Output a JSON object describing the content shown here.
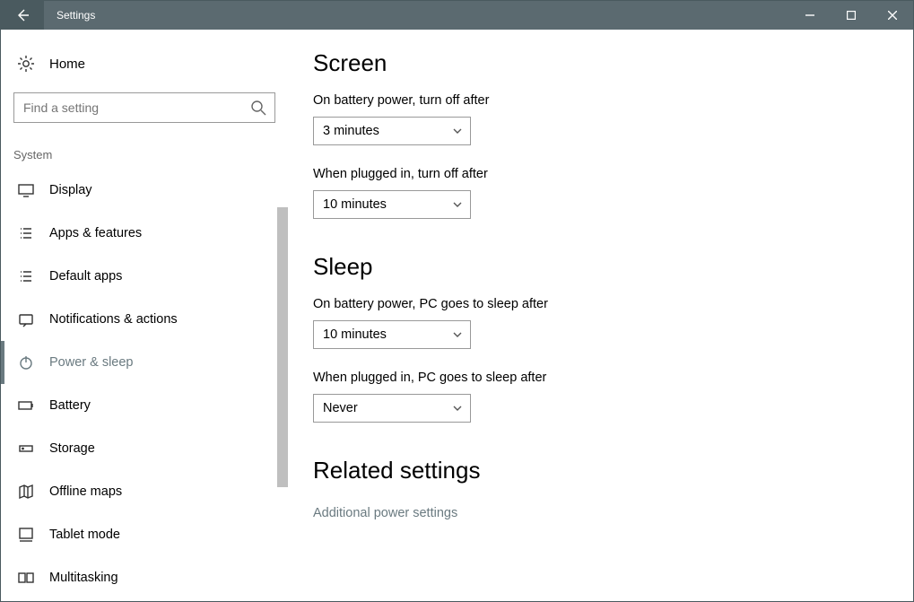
{
  "titlebar": {
    "title": "Settings"
  },
  "sidebar": {
    "home_label": "Home",
    "search_placeholder": "Find a setting",
    "section_label": "System",
    "items": [
      {
        "label": "Display"
      },
      {
        "label": "Apps & features"
      },
      {
        "label": "Default apps"
      },
      {
        "label": "Notifications & actions"
      },
      {
        "label": "Power & sleep"
      },
      {
        "label": "Battery"
      },
      {
        "label": "Storage"
      },
      {
        "label": "Offline maps"
      },
      {
        "label": "Tablet mode"
      },
      {
        "label": "Multitasking"
      }
    ],
    "selected_index": 4
  },
  "content": {
    "sections": [
      {
        "heading": "Screen",
        "fields": [
          {
            "label": "On battery power, turn off after",
            "value": "3 minutes"
          },
          {
            "label": "When plugged in, turn off after",
            "value": "10 minutes"
          }
        ]
      },
      {
        "heading": "Sleep",
        "fields": [
          {
            "label": "On battery power, PC goes to sleep after",
            "value": "10 minutes"
          },
          {
            "label": "When plugged in, PC goes to sleep after",
            "value": "Never"
          }
        ]
      }
    ],
    "related_heading": "Related settings",
    "related_link": "Additional power settings"
  }
}
